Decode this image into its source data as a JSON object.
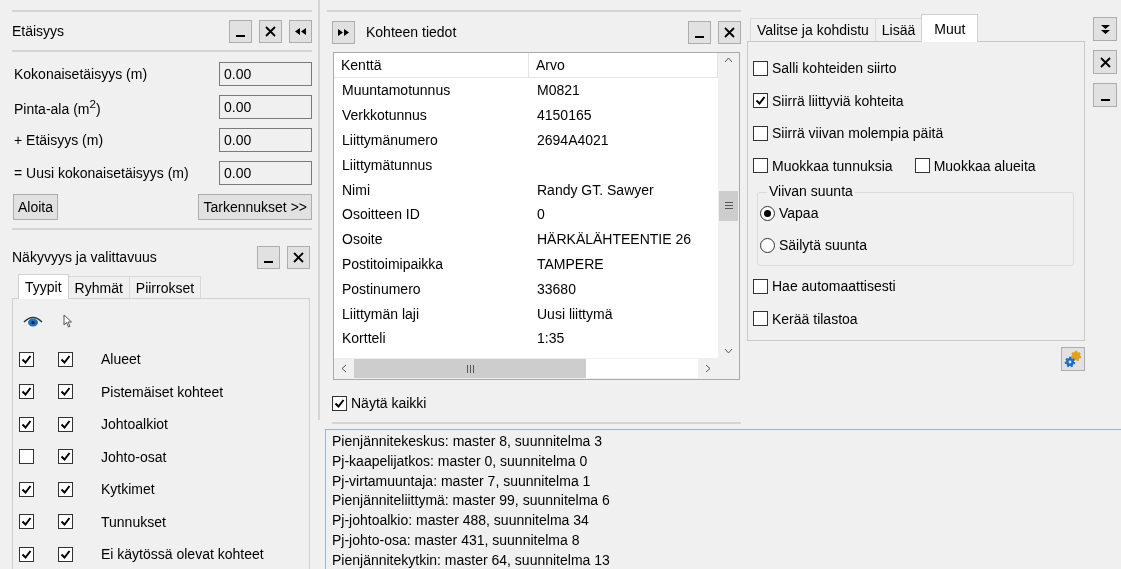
{
  "distance_panel": {
    "title": "Etäisyys",
    "fields": [
      {
        "label": "Kokonaisetäisyys (m)",
        "value": "0.00"
      },
      {
        "label": "Pinta-ala (m$^{2}$)",
        "value": "0.00"
      },
      {
        "label": "+ Etäisyys (m)",
        "value": "0.00"
      },
      {
        "label": "= Uusi kokonaisetäisyys (m)",
        "value": "0.00"
      }
    ],
    "buttons": [
      "Aloita",
      "Tarkennukset >>"
    ]
  },
  "visibility_panel": {
    "title": "Näkyvyys ja valittavuus",
    "tabs": [
      {
        "label": "Tyypit",
        "selected": true
      },
      {
        "label": "Ryhmät",
        "selected": false
      },
      {
        "label": "Piirrokset",
        "selected": false
      }
    ],
    "layers": [
      {
        "label": "Alueet",
        "visible": true,
        "selectable": true
      },
      {
        "label": "Pistemäiset kohteet",
        "visible": true,
        "selectable": true
      },
      {
        "label": "Johtoalkiot",
        "visible": true,
        "selectable": true
      },
      {
        "label": "Johto-osat",
        "visible": false,
        "selectable": true
      },
      {
        "label": "Kytkimet",
        "visible": true,
        "selectable": true
      },
      {
        "label": "Tunnukset",
        "visible": true,
        "selectable": true
      },
      {
        "label": "Ei käytössä olevat kohteet",
        "visible": true,
        "selectable": true
      }
    ]
  },
  "info_panel": {
    "title": "Kohteen tiedot",
    "table": {
      "columns": [
        "Kenttä",
        "Arvo"
      ],
      "rows": [
        {
          "field": "Muuntamotunnus",
          "value": "M0821"
        },
        {
          "field": "Verkkotunnus",
          "value": "4150165"
        },
        {
          "field": "Liittymänumero",
          "value": "2694A4021"
        },
        {
          "field": "Liittymätunnus"
        },
        {
          "field": "Nimi",
          "value": "Randy GT. Sawyer"
        },
        {
          "field": "Osoitteen ID",
          "value": "0"
        },
        {
          "field": "Osoite",
          "value": "HÄRKÄLÄHTEENTIE 26"
        },
        {
          "field": "Postitoimipaikka",
          "value": "TAMPERE"
        },
        {
          "field": "Postinumero",
          "value": "33680"
        },
        {
          "field": "Liittymän laji",
          "value": "Uusi liittymä"
        },
        {
          "field": "Kortteli",
          "value": "1:35"
        }
      ]
    },
    "show_all": {
      "label": "Näytä kaikki",
      "checked": true
    }
  },
  "options_panel": {
    "tabs": [
      {
        "label": "Valitse ja kohdistu",
        "selected": false
      },
      {
        "label": "Lisää",
        "selected": false
      },
      {
        "label": "Muut",
        "selected": true
      }
    ],
    "rows": [
      [
        {
          "label": "Salli kohteiden siirto",
          "checked": false
        }
      ],
      [
        {
          "label": "Siirrä liittyviä kohteita",
          "checked": true
        }
      ],
      [
        {
          "label": "Siirrä viivan molempia päitä",
          "checked": false
        }
      ],
      [
        {
          "label": "Muokkaa tunnuksia",
          "checked": false
        },
        {
          "label": "Muokkaa alueita",
          "checked": false
        }
      ]
    ],
    "direction": {
      "title": "Viivan suunta",
      "choices": [
        {
          "label": "Vapaa",
          "selected": true
        },
        {
          "label": "Säilytä suunta",
          "selected": false
        }
      ]
    },
    "extras": [
      {
        "label": "Hae automaattisesti",
        "checked": false
      },
      {
        "label": "Kerää tilastoa",
        "checked": false
      }
    ]
  },
  "log": [
    "Pienjännitekeskus: master 8, suunnitelma 3",
    "Pj-kaapelijatkos: master 0, suunnitelma 0",
    "Pj-virtamuuntaja: master 7, suunnitelma 1",
    "Pienjänniteliittymä: master 99, suunnitelma 6",
    "Pj-johtoalkio: master 488, suunnitelma 34",
    "Pj-johto-osa: master 431, suunnitelma 8",
    "Pienjännitekytkin: master 64, suunnitelma 13"
  ]
}
